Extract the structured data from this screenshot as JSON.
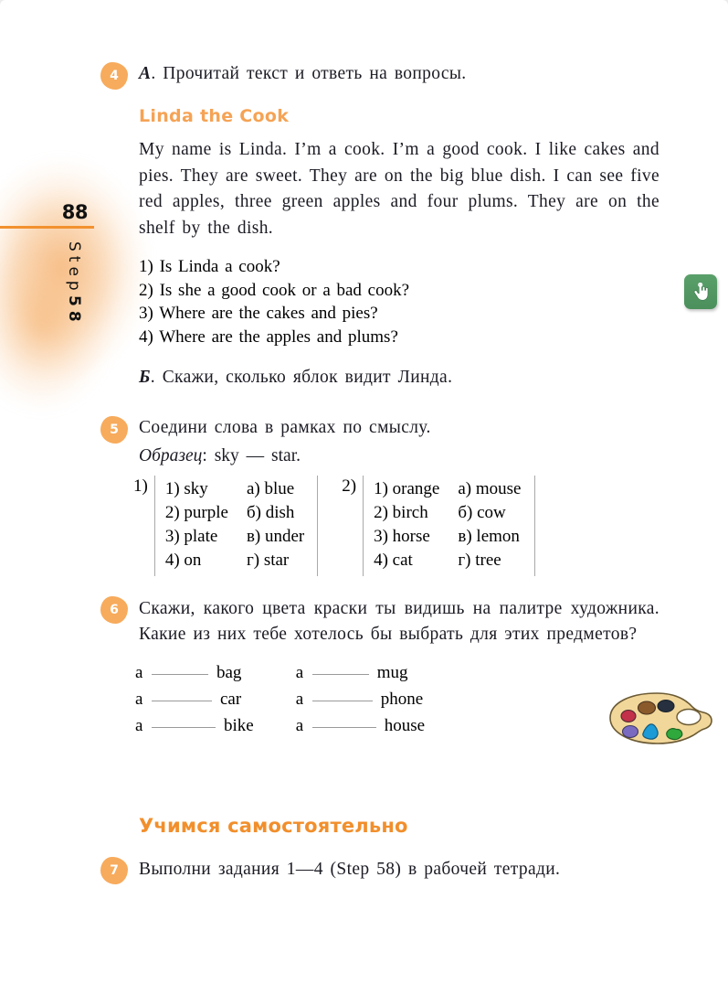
{
  "page": {
    "number": "88",
    "step_label": "Step",
    "step_number": "58",
    "accent_orange": "#F5A355",
    "accent_orange_dark": "#F18F2C",
    "badge_color": "#F7AB5C",
    "side_button_color": "#4b8f5c"
  },
  "side_button": {
    "icon": "hand-touch-icon"
  },
  "exercises": [
    {
      "number": "4",
      "part_a_marker": "А",
      "part_a_text": ". Прочитай текст и ответь на вопросы.",
      "story_title": "Linda the Cook",
      "story_text": "My name is Linda. I’m a cook. I’m a good cook. I like cakes and pies. They are sweet. They are on the big blue dish. I can see five red apples, three green apples and four plums. They are on the shelf by the dish.",
      "questions": [
        "1) Is Linda a cook?",
        "2) Is she a good cook or a bad cook?",
        "3) Where are the cakes and pies?",
        "4) Where are the apples and plums?"
      ],
      "part_b_marker": "Б",
      "part_b_text": ". Скажи, сколько яблок видит Линда."
    },
    {
      "number": "5",
      "instruction": "Соедини слова в рамках по смыслу.",
      "example_label": "Образец",
      "example_text": ": sky — star.",
      "groups": [
        {
          "label": "1)",
          "left": [
            "1) sky",
            "2) purple",
            "3) plate",
            "4) on"
          ],
          "right": [
            "а) blue",
            "б) dish",
            "в) under",
            "г) star"
          ]
        },
        {
          "label": "2)",
          "left": [
            "1) orange",
            "2) birch",
            "3) horse",
            "4) cat"
          ],
          "right": [
            "а) mouse",
            "б) cow",
            "в) lemon",
            "г) tree"
          ]
        }
      ]
    },
    {
      "number": "6",
      "instruction": "Скажи, какого цвета краски ты видишь на палитре художника. Какие из них тебе хотелось бы выбрать для этих предметов?",
      "blank_columns": [
        [
          {
            "article": "a",
            "word": "bag"
          },
          {
            "article": "a",
            "word": "car"
          },
          {
            "article": "a",
            "word": "bike"
          }
        ],
        [
          {
            "article": "a",
            "word": "mug"
          },
          {
            "article": "a",
            "word": "phone"
          },
          {
            "article": "a",
            "word": "house"
          }
        ]
      ],
      "illustration": "artist-palette-illustration"
    },
    {
      "number": "7",
      "section_heading": "Учимся самостоятельно",
      "instruction": "Выполни задания 1—4 (Step 58) в рабочей тетради."
    }
  ]
}
